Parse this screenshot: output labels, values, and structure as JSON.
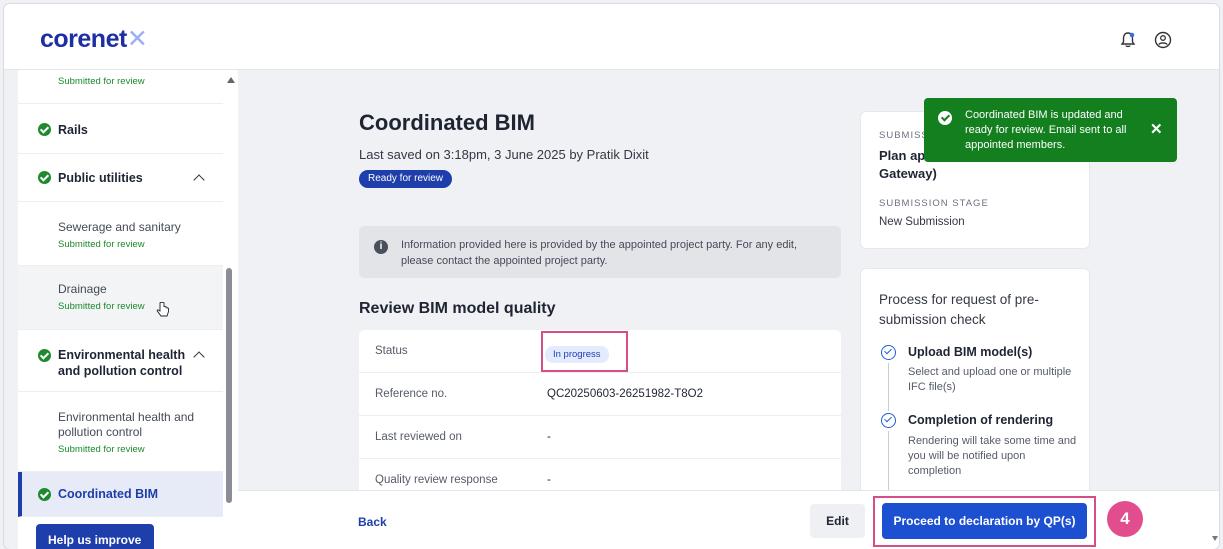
{
  "header": {
    "logo_text": "corenet",
    "logo_mark": "✕",
    "icons": [
      "bell-icon",
      "user-icon"
    ]
  },
  "sidebar": {
    "items": [
      {
        "label": "",
        "status": "Submitted for review"
      },
      {
        "label": "Rails"
      },
      {
        "label": "Public utilities"
      },
      {
        "label": "Sewerage and sanitary",
        "status": "Submitted for review"
      },
      {
        "label": "Drainage",
        "status": "Submitted for review"
      },
      {
        "label": "Environmental health and pollution control"
      },
      {
        "label": "Environmental health and pollution control",
        "status": "Submitted for review"
      },
      {
        "label": "Coordinated BIM"
      }
    ],
    "help_label": "Help us improve"
  },
  "main": {
    "title": "Coordinated BIM",
    "saved_text": "Last saved on 3:18pm, 3 June 2025 by Pratik Dixit",
    "badge": "Ready for review",
    "info": "Information provided here is provided by the appointed project party. For any edit, please contact the appointed project party.",
    "section_title": "Review BIM model quality",
    "rows": [
      {
        "label": "Status",
        "value": "In progress"
      },
      {
        "label": "Reference no.",
        "value": "QC20250603-26251982-T8O2"
      },
      {
        "label": "Last reviewed on",
        "value": "-"
      },
      {
        "label": "Quality review response",
        "value": "-"
      }
    ]
  },
  "submission": {
    "label1": "SUBMISS",
    "value1a": "Plan ap",
    "value1b": "Gateway)",
    "label2": "SUBMISSION STAGE",
    "value2": "New Submission"
  },
  "process": {
    "title": "Process for request of pre-submission check",
    "steps": [
      {
        "title": "Upload BIM model(s)",
        "desc": "Select and upload one or multiple IFC file(s)"
      },
      {
        "title": "Completion of rendering",
        "desc": "Rendering will take some time and you will be notified upon completion"
      }
    ]
  },
  "toast": {
    "text": "Coordinated BIM is updated and ready for review. Email sent to all appointed members.",
    "close": "✕"
  },
  "footer": {
    "back": "Back",
    "edit": "Edit",
    "proceed": "Proceed to declaration by QP(s)"
  },
  "annotation": {
    "step_number": "4"
  },
  "colors": {
    "brand_blue": "#1d3eab",
    "success_green": "#137f1f",
    "highlight_pink": "#d84c88"
  }
}
